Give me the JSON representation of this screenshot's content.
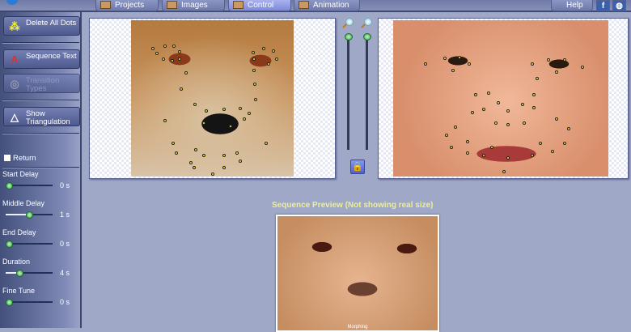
{
  "tabs": [
    {
      "label": "Projects"
    },
    {
      "label": "Images"
    },
    {
      "label": "Control",
      "active": true
    },
    {
      "label": "Animation"
    }
  ],
  "header": {
    "help_label": "Help",
    "facebook": "f",
    "web": "◍"
  },
  "sidebar": {
    "delete_dots": "Delete All Dots",
    "sequence_text": "Sequence Text",
    "transition_types": "Transition Types",
    "show_triangulation": "Show Triangulation",
    "return_label": "Return",
    "return_checked": false,
    "sliders": [
      {
        "label": "Start Delay",
        "value": "0 s",
        "fraction": 0
      },
      {
        "label": "Middle Delay",
        "value": "1 s",
        "fraction": 0.5
      },
      {
        "label": "End Delay",
        "value": "0 s",
        "fraction": 0
      },
      {
        "label": "Duration",
        "value": "4 s",
        "fraction": 0.25
      },
      {
        "label": "Fine Tune",
        "value": "0 s",
        "fraction": 0
      }
    ]
  },
  "preview": {
    "title": "Sequence Preview (Not showing real size)",
    "caption": "Morphing"
  },
  "colors": {
    "accent": "#eef090",
    "dot": "#f2f030",
    "bg": "#a0a8c8"
  }
}
